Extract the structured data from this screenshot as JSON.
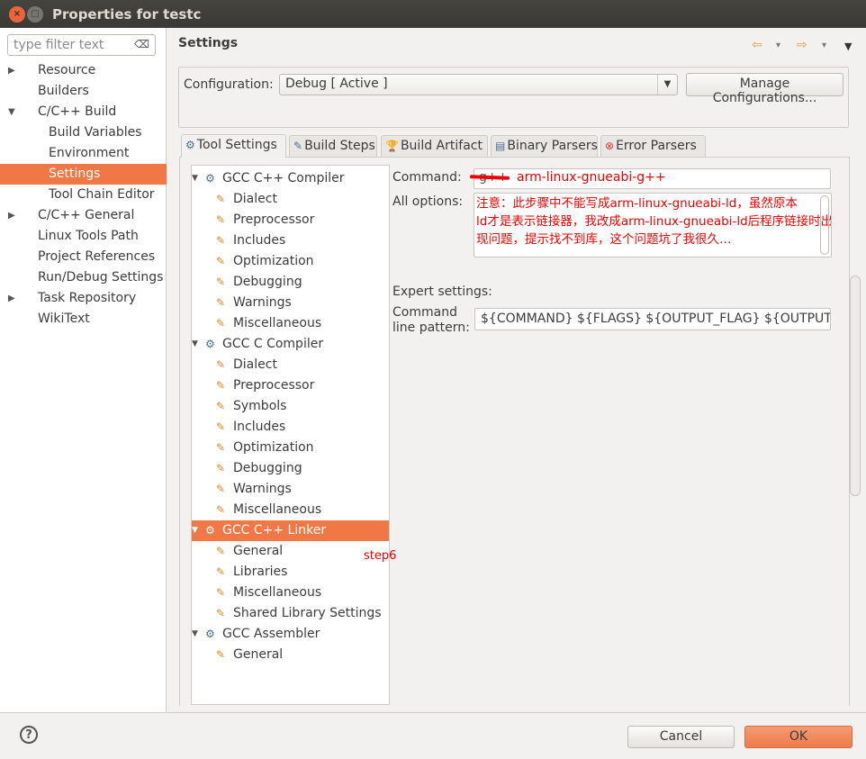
{
  "window": {
    "title": "Properties for testc",
    "close_glyph": "×",
    "min_glyph": "□"
  },
  "filter": {
    "placeholder": "type filter text",
    "clear_glyph": "⌫"
  },
  "nav": [
    {
      "label": "Resource",
      "arrow": "▶",
      "level": 0
    },
    {
      "label": "Builders",
      "level": 0
    },
    {
      "label": "C/C++ Build",
      "arrow": "▼",
      "level": 0
    },
    {
      "label": "Build Variables",
      "level": 1
    },
    {
      "label": "Environment",
      "level": 1
    },
    {
      "label": "Settings",
      "level": 1,
      "selected": true
    },
    {
      "label": "Tool Chain Editor",
      "level": 1
    },
    {
      "label": "C/C++ General",
      "arrow": "▶",
      "level": 0
    },
    {
      "label": "Linux Tools Path",
      "level": 0
    },
    {
      "label": "Project References",
      "level": 0
    },
    {
      "label": "Run/Debug Settings",
      "level": 0
    },
    {
      "label": "Task Repository",
      "arrow": "▶",
      "level": 0
    },
    {
      "label": "WikiText",
      "level": 0
    }
  ],
  "header": {
    "title": "Settings"
  },
  "configuration": {
    "label": "Configuration:",
    "value": "Debug  [ Active ]",
    "manage_label": "Manage Configurations..."
  },
  "tabs": [
    {
      "label": "Tool Settings",
      "icon": "⚙",
      "active": true
    },
    {
      "label": "Build Steps",
      "icon": "✎"
    },
    {
      "label": "Build Artifact",
      "icon": "🏆"
    },
    {
      "label": "Binary Parsers",
      "icon": "▤"
    },
    {
      "label": "Error Parsers",
      "icon": "⊗"
    }
  ],
  "tree": [
    {
      "label": "GCC C++ Compiler",
      "level": 0
    },
    {
      "label": "Dialect",
      "level": 1
    },
    {
      "label": "Preprocessor",
      "level": 1
    },
    {
      "label": "Includes",
      "level": 1
    },
    {
      "label": "Optimization",
      "level": 1
    },
    {
      "label": "Debugging",
      "level": 1
    },
    {
      "label": "Warnings",
      "level": 1
    },
    {
      "label": "Miscellaneous",
      "level": 1
    },
    {
      "label": "GCC C Compiler",
      "level": 0
    },
    {
      "label": "Dialect",
      "level": 1
    },
    {
      "label": "Preprocessor",
      "level": 1
    },
    {
      "label": "Symbols",
      "level": 1
    },
    {
      "label": "Includes",
      "level": 1
    },
    {
      "label": "Optimization",
      "level": 1
    },
    {
      "label": "Debugging",
      "level": 1
    },
    {
      "label": "Warnings",
      "level": 1
    },
    {
      "label": "Miscellaneous",
      "level": 1
    },
    {
      "label": "GCC C++ Linker",
      "level": 0,
      "selected": true
    },
    {
      "label": "General",
      "level": 1
    },
    {
      "label": "Libraries",
      "level": 1
    },
    {
      "label": "Miscellaneous",
      "level": 1
    },
    {
      "label": "Shared Library Settings",
      "level": 1
    },
    {
      "label": "GCC Assembler",
      "level": 0
    },
    {
      "label": "General",
      "level": 1
    }
  ],
  "settings": {
    "command_label": "Command:",
    "command_old": "g++",
    "command_new": "arm-linux-gnueabi-g++",
    "all_options_label": "All options:",
    "all_options_lines": [
      "注意：此步骤中不能写成arm-linux-gnueabi-ld，虽然原本",
      "ld才是表示链接器，我改成arm-linux-gnueabi-ld后程序链接时出",
      "现问题，提示找不到库，这个问题坑了我很久…"
    ],
    "expert_label": "Expert settings:",
    "pattern_label_1": "Command",
    "pattern_label_2": "line pattern:",
    "pattern_value": "${COMMAND} ${FLAGS} ${OUTPUT_FLAG} ${OUTPUT_PREFIX}${OUTPUT}"
  },
  "annotation": "step6",
  "footer": {
    "help": "?",
    "cancel": "Cancel",
    "ok": "OK"
  },
  "nav_arrows": {
    "back": "⇦",
    "fwd": "⇨",
    "dd": "▾",
    "menu": "▼"
  }
}
